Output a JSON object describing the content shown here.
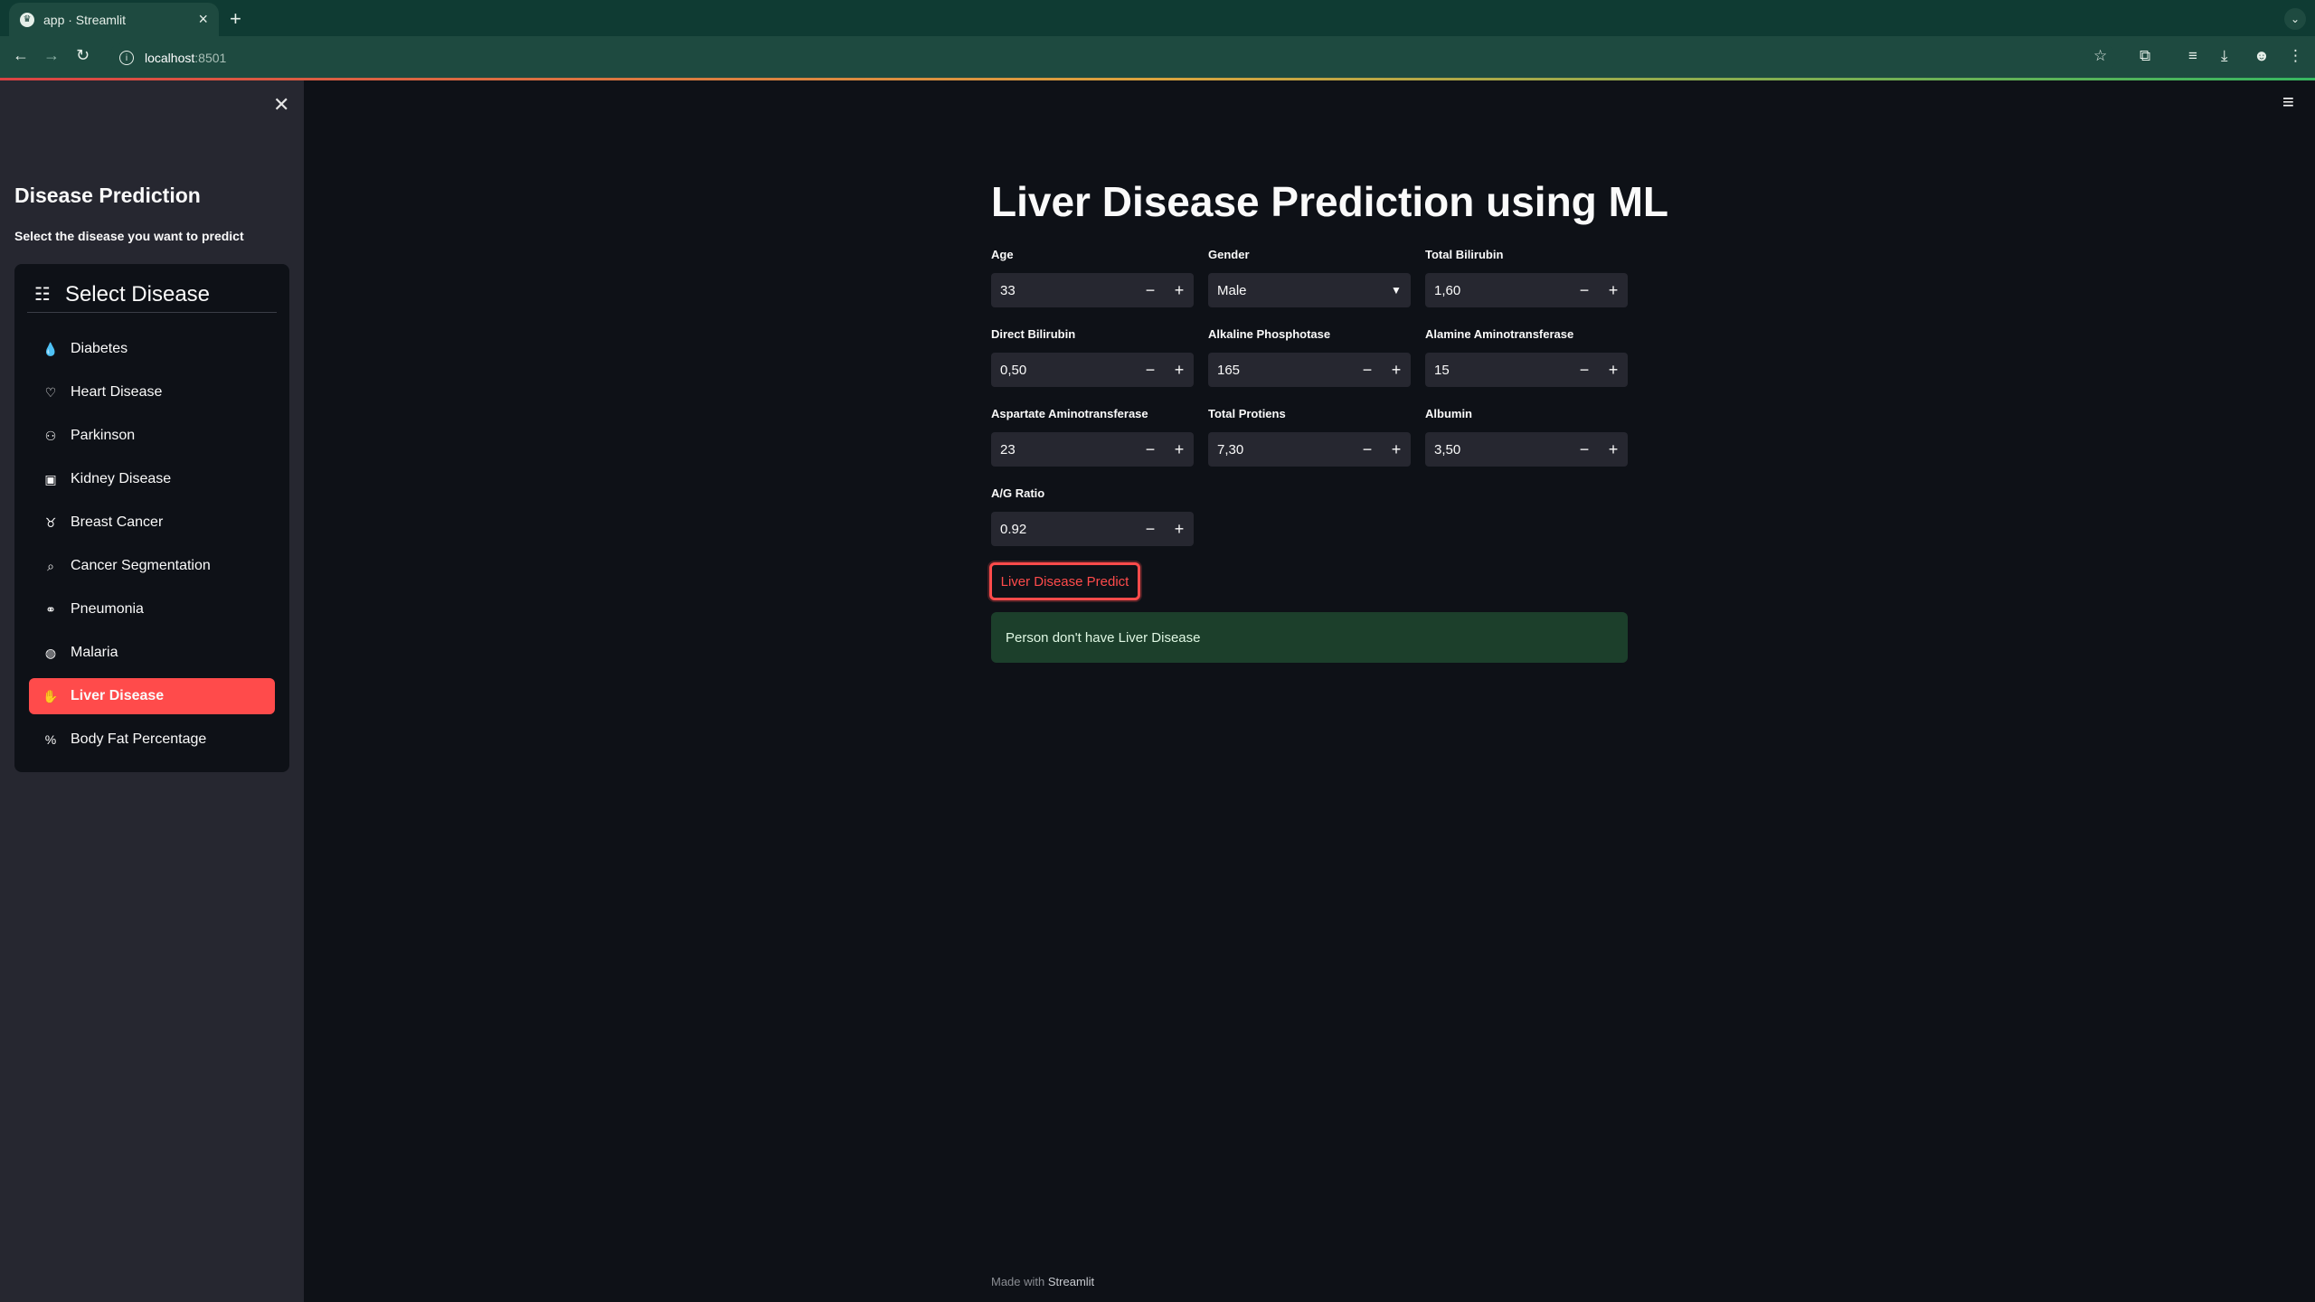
{
  "browser": {
    "tab_title": "app · Streamlit",
    "url_host": "localhost",
    "url_port": ":8501"
  },
  "sidebar": {
    "title": "Disease Prediction",
    "subtitle": "Select the disease you want to predict",
    "menu_title": "Select Disease",
    "items": [
      {
        "label": "Diabetes",
        "icon": "droplet-icon",
        "active": false
      },
      {
        "label": "Heart Disease",
        "icon": "heart-icon",
        "active": false
      },
      {
        "label": "Parkinson",
        "icon": "person-icon",
        "active": false
      },
      {
        "label": "Kidney Disease",
        "icon": "kidney-icon",
        "active": false
      },
      {
        "label": "Breast Cancer",
        "icon": "ribbon-icon",
        "active": false
      },
      {
        "label": "Cancer Segmentation",
        "icon": "search-icon",
        "active": false
      },
      {
        "label": "Pneumonia",
        "icon": "lungs-icon",
        "active": false
      },
      {
        "label": "Malaria",
        "icon": "virus-icon",
        "active": false
      },
      {
        "label": "Liver Disease",
        "icon": "hand-icon",
        "active": true
      },
      {
        "label": "Body Fat Percentage",
        "icon": "percent-icon",
        "active": false
      }
    ]
  },
  "main": {
    "title": "Liver Disease Prediction using ML",
    "fields": {
      "age": {
        "label": "Age",
        "value": "33"
      },
      "gender": {
        "label": "Gender",
        "value": "Male"
      },
      "total_bilirubin": {
        "label": "Total Bilirubin",
        "value": "1,60"
      },
      "direct_bilirubin": {
        "label": "Direct Bilirubin",
        "value": "0,50"
      },
      "alkaline_phosphotase": {
        "label": "Alkaline Phosphotase",
        "value": "165"
      },
      "alamine_aminotransferase": {
        "label": "Alamine Aminotransferase",
        "value": "15"
      },
      "aspartate_aminotransferase": {
        "label": "Aspartate Aminotransferase",
        "value": "23"
      },
      "total_protiens": {
        "label": "Total Protiens",
        "value": "7,30"
      },
      "albumin": {
        "label": "Albumin",
        "value": "3,50"
      },
      "ag_ratio": {
        "label": "A/G Ratio",
        "value": "0.92"
      }
    },
    "predict_button": "Liver Disease Predict",
    "result": "Person don't have Liver Disease"
  },
  "footer": {
    "prefix": "Made with",
    "brand": "Streamlit"
  },
  "colors": {
    "accent": "#ff4b4b",
    "sidebar_bg": "#262730",
    "main_bg": "#0e1117",
    "success_bg": "#1c3f2b"
  }
}
